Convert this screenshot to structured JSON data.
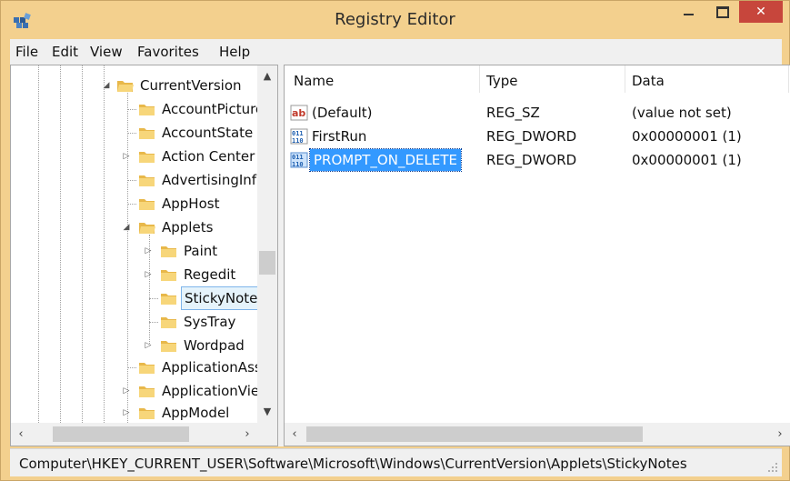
{
  "window": {
    "title": "Registry Editor",
    "close_glyph": "✕",
    "accent_titlebar": "#f3d08e",
    "close_color": "#c7463c",
    "selection_color": "#3399ff"
  },
  "menubar": {
    "items": [
      "File",
      "Edit",
      "View",
      "Favorites",
      "Help"
    ]
  },
  "tree": {
    "nodes": [
      {
        "label": "CurrentVersion",
        "expander": "expanded"
      },
      {
        "label": "AccountPicture",
        "expander": "none"
      },
      {
        "label": "AccountState",
        "expander": "none"
      },
      {
        "label": "Action Center",
        "expander": "collapsed"
      },
      {
        "label": "AdvertisingInfo",
        "expander": "none"
      },
      {
        "label": "AppHost",
        "expander": "none"
      },
      {
        "label": "Applets",
        "expander": "expanded"
      },
      {
        "label": "Paint",
        "expander": "collapsed"
      },
      {
        "label": "Regedit",
        "expander": "collapsed"
      },
      {
        "label": "StickyNotes",
        "expander": "none",
        "selected": true
      },
      {
        "label": "SysTray",
        "expander": "none"
      },
      {
        "label": "Wordpad",
        "expander": "collapsed"
      },
      {
        "label": "ApplicationAss",
        "expander": "none"
      },
      {
        "label": "ApplicationViev",
        "expander": "collapsed"
      },
      {
        "label": "AppModel",
        "expander": "collapsed"
      }
    ]
  },
  "list": {
    "columns": [
      "Name",
      "Type",
      "Data"
    ],
    "rows": [
      {
        "icon": "string-value-icon",
        "name": "(Default)",
        "type": "REG_SZ",
        "data": "(value not set)"
      },
      {
        "icon": "dword-value-icon",
        "name": "FirstRun",
        "type": "REG_DWORD",
        "data": "0x00000001 (1)"
      },
      {
        "icon": "dword-value-icon",
        "name": "PROMPT_ON_DELETE",
        "type": "REG_DWORD",
        "data": "0x00000001 (1)",
        "selected": true
      }
    ]
  },
  "statusbar": {
    "path": "Computer\\HKEY_CURRENT_USER\\Software\\Microsoft\\Windows\\CurrentVersion\\Applets\\StickyNotes"
  }
}
